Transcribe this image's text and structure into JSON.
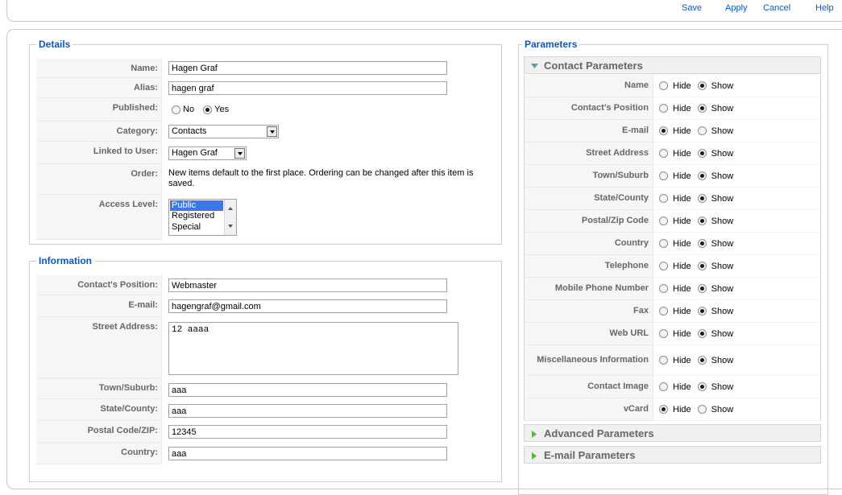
{
  "toolbar": {
    "save": "Save",
    "apply": "Apply",
    "cancel": "Cancel",
    "help": "Help"
  },
  "details": {
    "legend": "Details",
    "name_label": "Name:",
    "name_value": "Hagen Graf",
    "alias_label": "Alias:",
    "alias_value": "hagen graf",
    "published_label": "Published:",
    "published_no": "No",
    "published_yes": "Yes",
    "published_selected": "Yes",
    "category_label": "Category:",
    "category_value": "Contacts",
    "linked_label": "Linked to User:",
    "linked_value": "Hagen Graf",
    "order_label": "Order:",
    "order_text": "New items default to the first place. Ordering can be changed after this item is saved.",
    "access_label": "Access Level:",
    "access_options": [
      "Public",
      "Registered",
      "Special"
    ],
    "access_selected": "Public"
  },
  "information": {
    "legend": "Information",
    "position_label": "Contact's Position:",
    "position_value": "Webmaster",
    "email_label": "E-mail:",
    "email_value": "hagengraf@gmail.com",
    "street_label": "Street Address:",
    "street_value": "12 aaaa",
    "town_label": "Town/Suburb:",
    "town_value": "aaa",
    "state_label": "State/County:",
    "state_value": "aaa",
    "postal_label": "Postal Code/ZIP:",
    "postal_value": "12345",
    "country_label": "Country:",
    "country_value": "aaa"
  },
  "parameters": {
    "legend": "Parameters",
    "contact_header": "Contact Parameters",
    "hide_label": "Hide",
    "show_label": "Show",
    "rows": [
      {
        "label": "Name",
        "selected": "Show"
      },
      {
        "label": "Contact's Position",
        "selected": "Show"
      },
      {
        "label": "E-mail",
        "selected": "Hide"
      },
      {
        "label": "Street Address",
        "selected": "Show"
      },
      {
        "label": "Town/Suburb",
        "selected": "Show"
      },
      {
        "label": "State/County",
        "selected": "Show"
      },
      {
        "label": "Postal/Zip Code",
        "selected": "Show"
      },
      {
        "label": "Country",
        "selected": "Show"
      },
      {
        "label": "Telephone",
        "selected": "Show"
      },
      {
        "label": "Mobile Phone Number",
        "selected": "Show"
      },
      {
        "label": "Fax",
        "selected": "Show"
      },
      {
        "label": "Web URL",
        "selected": "Show"
      },
      {
        "label": "Miscellaneous Information",
        "selected": "Show"
      },
      {
        "label": "Contact Image",
        "selected": "Show"
      },
      {
        "label": "vCard",
        "selected": "Hide"
      }
    ],
    "advanced_header": "Advanced Parameters",
    "email_header": "E-mail Parameters"
  },
  "colors": {
    "legend": "#0b55c4",
    "label_text": "#666666",
    "label_bg": "#f6f6f6",
    "expanded_triangle": "#5f9ea0",
    "collapsed_triangle": "#58b336",
    "selection": "#3b78e7"
  }
}
